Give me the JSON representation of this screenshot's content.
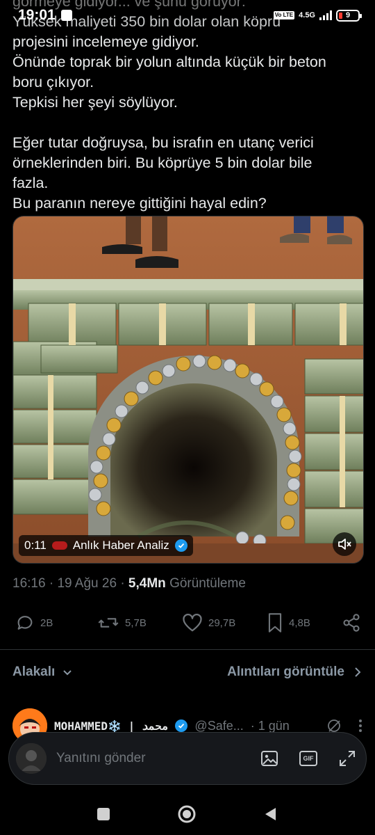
{
  "status_bar": {
    "time": "19:01",
    "volte": "Vo LTE",
    "network": "4.5G",
    "battery": "9"
  },
  "tweet": {
    "paragraph1": [
      "görmeye gidiyor... ve şunu görüyor:",
      "Yüksek maliyeti 350 bin dolar olan köprü",
      "projesini incelemeye gidiyor.",
      "Önünde toprak bir yolun altında küçük bir beton",
      "boru çıkıyor.",
      "Tepkisi her şeyi söylüyor."
    ],
    "paragraph2": [
      "Eğer tutar doğruysa, bu israfın en utanç verici",
      "örneklerinden biri. Bu köprüye 5 bin dolar bile",
      "fazla.",
      "Bu paranın nereye gittiğini hayal edin?"
    ]
  },
  "media": {
    "duration": "0:11",
    "source": "Anlık Haber Analiz"
  },
  "meta": {
    "time": "16:16",
    "date": "19 Ağu 26",
    "views_count": "5,4Mn",
    "views_label": "Görüntüleme"
  },
  "actions": {
    "replies": "2B",
    "reposts": "5,7B",
    "likes": "29,7B",
    "bookmarks": "4,8B"
  },
  "related": {
    "left": "Alakalı",
    "right": "Alıntıları görüntüle"
  },
  "reply_preview": {
    "name": "MOHAMMED❄️ | محمد",
    "handle": "@Safe...",
    "time": "· 1 gün"
  },
  "composer": {
    "placeholder": "Yanıtını gönder",
    "gif_label": "GIF"
  },
  "colors": {
    "background": "#000000",
    "text": "#e7e9ea",
    "muted": "#71767b",
    "accent": "#1d9bf0"
  }
}
